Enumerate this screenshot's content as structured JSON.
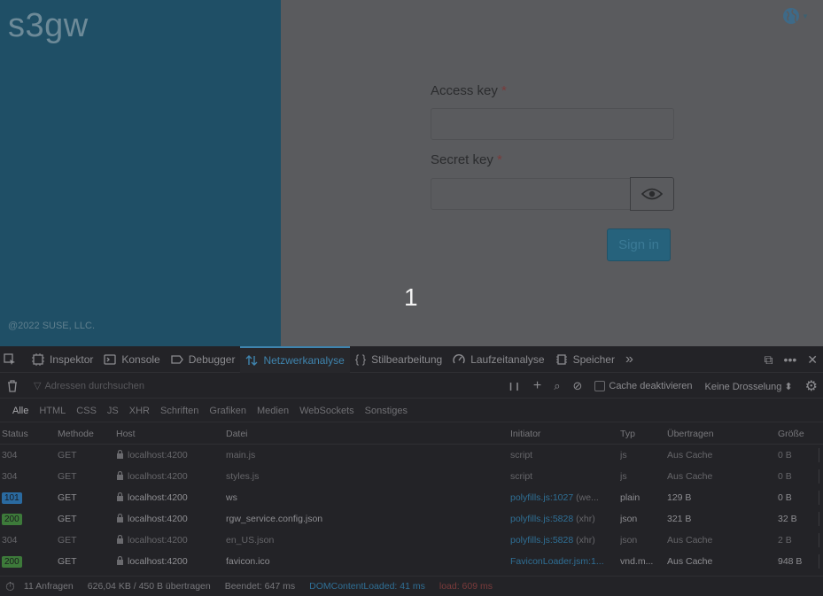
{
  "app": {
    "brand": "s3gw",
    "copyright": "@2022 SUSE, LLC.",
    "access_key_label": "Access key",
    "secret_key_label": "Secret key",
    "required_marker": "*",
    "access_key_value": "",
    "secret_key_value": "",
    "sign_in": "Sign in",
    "overlay_number": "1",
    "language_icon": "globe-icon"
  },
  "devtools": {
    "tabs": [
      {
        "label": "Inspektor",
        "icon": "inspector-icon"
      },
      {
        "label": "Konsole",
        "icon": "console-icon"
      },
      {
        "label": "Debugger",
        "icon": "debugger-icon"
      },
      {
        "label": "Netzwerkanalyse",
        "icon": "network-icon",
        "active": true
      },
      {
        "label": "Stilbearbeitung",
        "icon": "style-editor-icon"
      },
      {
        "label": "Laufzeitanalyse",
        "icon": "performance-icon"
      },
      {
        "label": "Speicher",
        "icon": "memory-icon"
      }
    ],
    "more_tabs": "»",
    "filter_placeholder": "Adressen durchsuchen",
    "pause": "❙❙",
    "disable_cache": "Cache deaktivieren",
    "throttling": "Keine Drosselung ⬍",
    "type_filters": [
      "Alle",
      "HTML",
      "CSS",
      "JS",
      "XHR",
      "Schriften",
      "Grafiken",
      "Medien",
      "WebSockets",
      "Sonstiges"
    ],
    "columns": {
      "status": "Status",
      "method": "Methode",
      "host": "Host",
      "file": "Datei",
      "initiator": "Initiator",
      "type": "Typ",
      "transferred": "Übertragen",
      "size": "Größe"
    },
    "rows": [
      {
        "status": "304",
        "method": "GET",
        "host": "localhost:4200",
        "file": "main.js",
        "initiator": "script",
        "type": "js",
        "transferred": "Aus Cache",
        "size": "0 B"
      },
      {
        "status": "304",
        "method": "GET",
        "host": "localhost:4200",
        "file": "styles.js",
        "initiator": "script",
        "type": "js",
        "transferred": "Aus Cache",
        "size": "0 B"
      },
      {
        "status": "101",
        "method": "GET",
        "host": "localhost:4200",
        "file": "ws",
        "initiator": "polyfills.js:1027",
        "initiator_suffix": "(we...",
        "type": "plain",
        "transferred": "129 B",
        "size": "0 B"
      },
      {
        "status": "200",
        "method": "GET",
        "host": "localhost:4200",
        "file": "rgw_service.config.json",
        "initiator": "polyfills.js:5828",
        "initiator_suffix": "(xhr)",
        "type": "json",
        "transferred": "321 B",
        "size": "32 B"
      },
      {
        "status": "304",
        "method": "GET",
        "host": "localhost:4200",
        "file": "en_US.json",
        "initiator": "polyfills.js:5828",
        "initiator_suffix": "(xhr)",
        "type": "json",
        "transferred": "Aus Cache",
        "size": "2 B"
      },
      {
        "status": "200",
        "method": "GET",
        "host": "localhost:4200",
        "file": "favicon.ico",
        "initiator": "FaviconLoader.jsm:1...",
        "initiator_suffix": "",
        "type": "vnd.m...",
        "transferred": "Aus Cache",
        "size": "948 B"
      }
    ],
    "status_bar": {
      "requests": "11 Anfragen",
      "transferred": "626,04 KB / 450 B übertragen",
      "finished": "Beendet: 647 ms",
      "dom": "DOMContentLoaded: 41 ms",
      "load": "load: 609 ms"
    },
    "colors": {
      "accent": "#3f84ae",
      "status_101": "#2a6aa0",
      "status_200": "#3d7a3a"
    }
  }
}
